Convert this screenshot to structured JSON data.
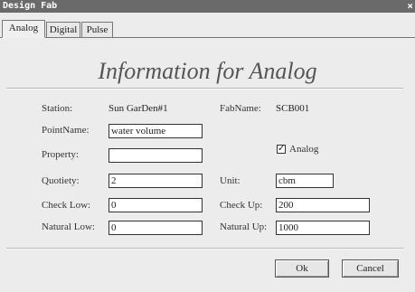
{
  "window": {
    "title": "Design Fab",
    "close_glyph": "×"
  },
  "tabs": [
    {
      "label": "Analog"
    },
    {
      "label": "Digital"
    },
    {
      "label": "Pulse"
    }
  ],
  "heading": "Information for Analog",
  "form": {
    "station_label": "Station:",
    "station_value": "Sun GarDen#1",
    "fabname_label": "FabName:",
    "fabname_value": "SCB001",
    "pointname_label": "PointName:",
    "pointname_value": "water volume",
    "property_label": "Property:",
    "property_value": "",
    "analog_label": "Analog",
    "analog_checked": true,
    "quotiety_label": "Quotiety:",
    "quotiety_value": "2",
    "unit_label": "Unit:",
    "unit_value": "cbm",
    "checklow_label": "Check Low:",
    "checklow_value": "0",
    "checkup_label": "Check Up:",
    "checkup_value": "200",
    "naturallow_label": "Natural Low:",
    "naturallow_value": "0",
    "naturalup_label": "Natural Up:",
    "naturalup_value": "1000"
  },
  "buttons": {
    "ok": "Ok",
    "cancel": "Cancel"
  }
}
